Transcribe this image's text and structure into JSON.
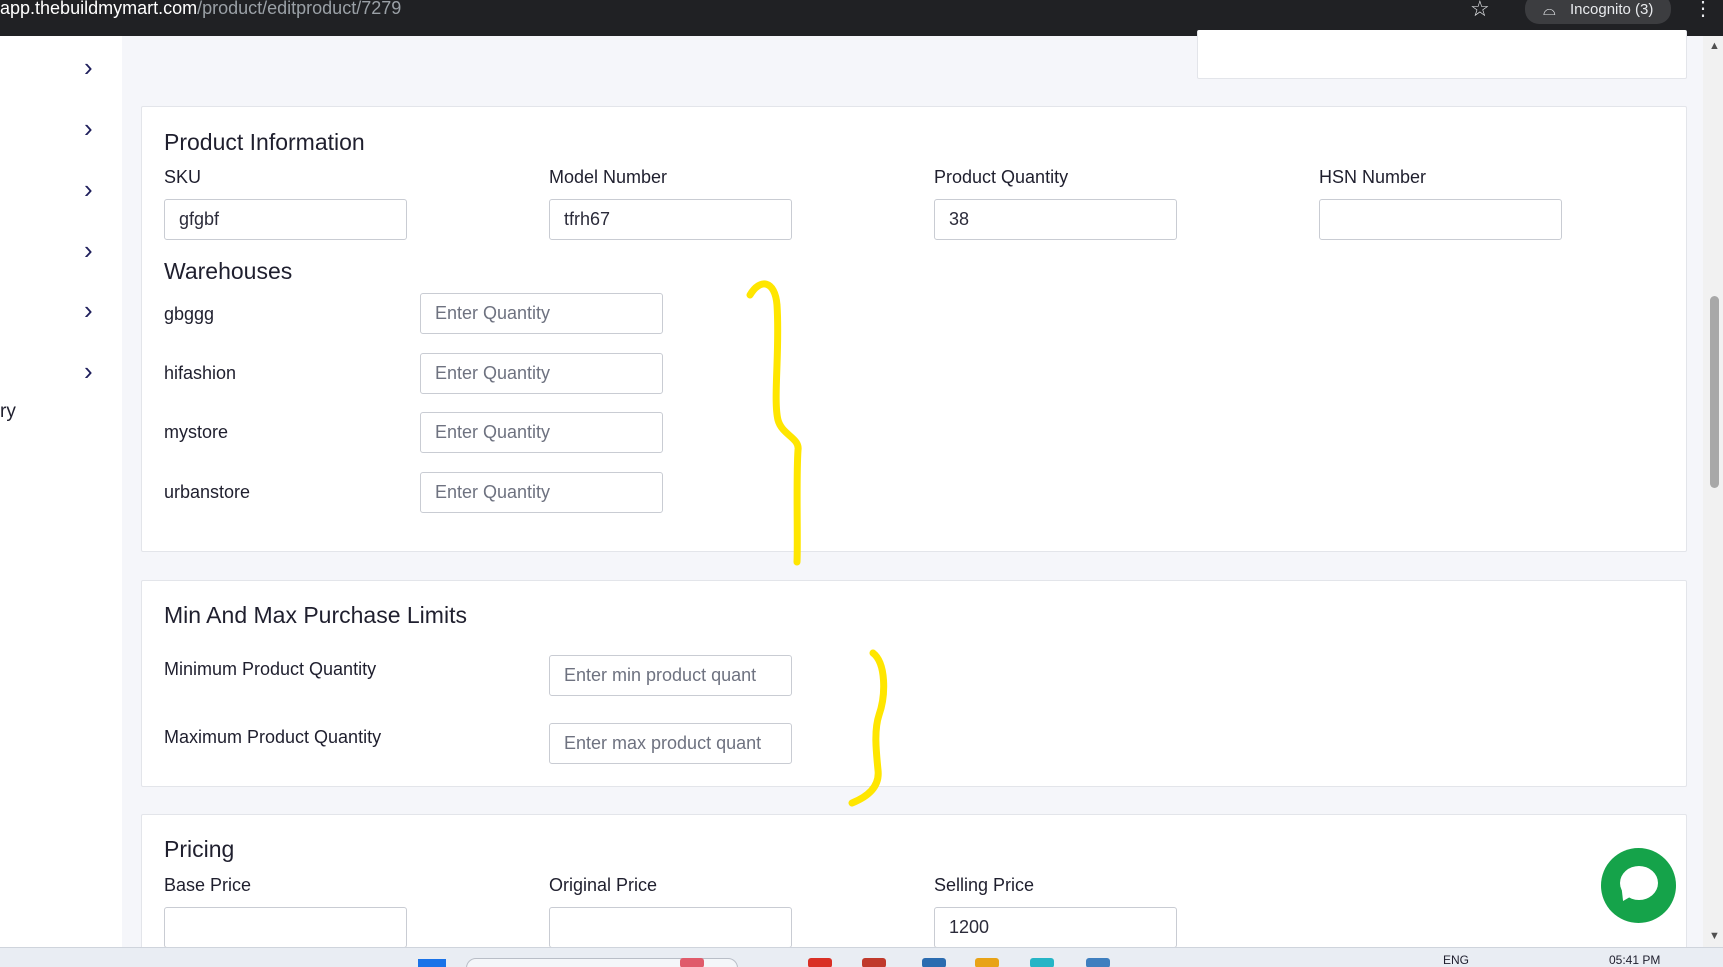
{
  "browser": {
    "url_host": "app.thebuildmymart.com",
    "url_path": "/product/editproduct/7279",
    "incognito_label": "Incognito (3)"
  },
  "sidebar": {
    "truncated_label": "ry"
  },
  "product_information": {
    "title": "Product Information",
    "sku_label": "SKU",
    "sku_value": "gfgbf",
    "model_label": "Model Number",
    "model_value": "tfrh67",
    "quantity_label": "Product Quantity",
    "quantity_value": "38",
    "hsn_label": "HSN Number",
    "hsn_value": ""
  },
  "warehouses": {
    "title": "Warehouses",
    "placeholder": "Enter Quantity",
    "items": [
      {
        "name": "gbggg"
      },
      {
        "name": "hifashion"
      },
      {
        "name": "mystore"
      },
      {
        "name": "urbanstore"
      }
    ]
  },
  "purchase_limits": {
    "title": "Min And Max Purchase Limits",
    "min_label": "Minimum Product Quantity",
    "min_placeholder": "Enter min product quant",
    "max_label": "Maximum Product Quantity",
    "max_placeholder": "Enter max product quant"
  },
  "pricing": {
    "title": "Pricing",
    "base_label": "Base Price",
    "base_value": "",
    "original_label": "Original Price",
    "original_value": "",
    "selling_label": "Selling Price",
    "selling_value": "1200"
  },
  "taskbar": {
    "language": "ENG",
    "time": "05:41 PM"
  },
  "colors": {
    "accent_chat": "#15a34a",
    "annotation_yellow": "#ffe600"
  }
}
